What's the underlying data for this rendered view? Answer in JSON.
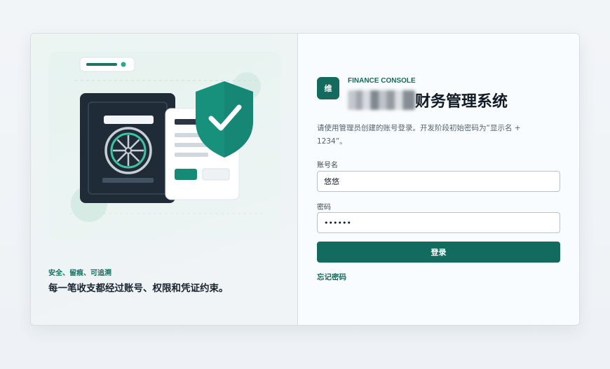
{
  "hero": {
    "tagline": "安全、留痕、可追溯",
    "headline": "每一笔收支都经过账号、权限和凭证约束。"
  },
  "brand": {
    "icon_char": "维",
    "console_label": "FINANCE CONSOLE",
    "title": "财务管理系统"
  },
  "form": {
    "hint": "请使用管理员创建的账号登录。开发阶段初始密码为“显示名 + 1234”。",
    "username_label": "账号名",
    "username_value": "悠悠",
    "password_label": "密码",
    "password_value": "••••••",
    "submit_label": "登录",
    "forgot_label": "忘记密码"
  },
  "colors": {
    "accent": "#136b5f",
    "shield": "#17907c",
    "passport": "#1f2c38"
  }
}
